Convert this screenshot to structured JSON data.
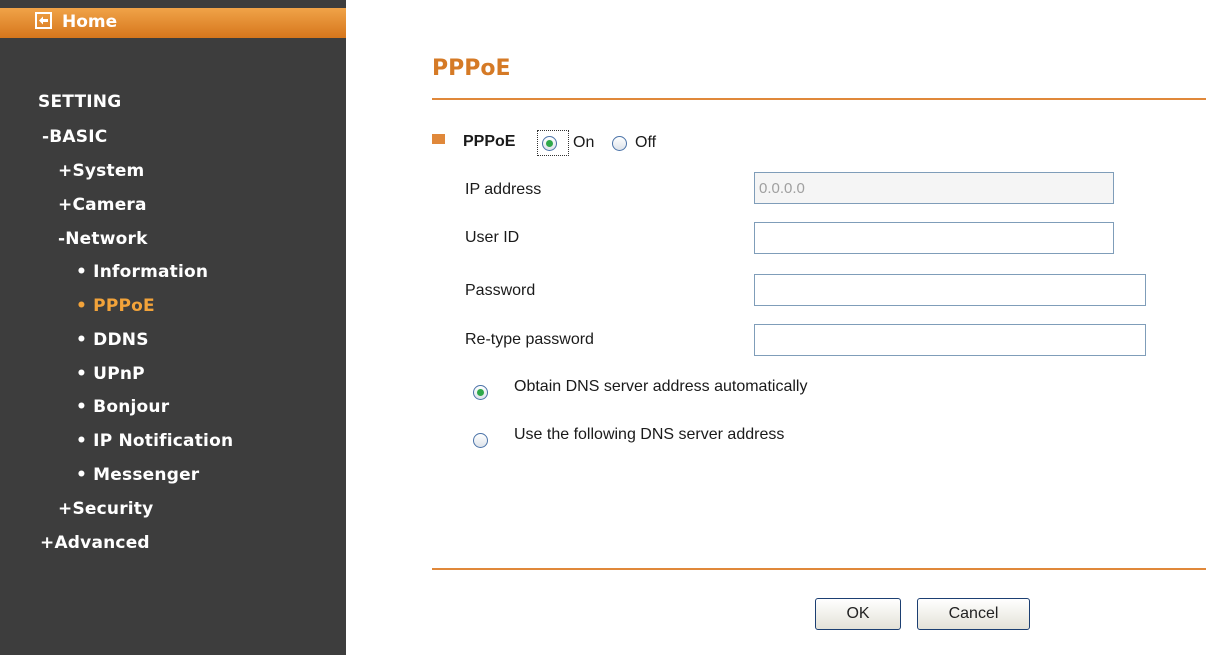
{
  "sidebar": {
    "home_label": "Home",
    "items": [
      {
        "label": "SETTING"
      },
      {
        "label": "-BASIC"
      },
      {
        "label": "+System"
      },
      {
        "label": "+Camera"
      },
      {
        "label": "-Network"
      },
      {
        "label": "• Information"
      },
      {
        "label": "• PPPoE"
      },
      {
        "label": "• DDNS"
      },
      {
        "label": "• UPnP"
      },
      {
        "label": "• Bonjour"
      },
      {
        "label": "• IP Notification"
      },
      {
        "label": "• Messenger"
      },
      {
        "label": "+Security"
      },
      {
        "label": "+Advanced"
      }
    ],
    "active_color": "#f2a33a"
  },
  "main": {
    "title": "PPPoE",
    "pppoe_label": "PPPoE",
    "on_label": "On",
    "off_label": "Off",
    "pppoe_selected": "On",
    "ip_address": {
      "label": "IP address",
      "value": "0.0.0.0"
    },
    "user_id": {
      "label": "User ID",
      "value": ""
    },
    "password": {
      "label": "Password",
      "value": ""
    },
    "retype_password": {
      "label": "Re-type password",
      "value": ""
    },
    "dns_auto_label": "Obtain DNS server address automatically",
    "dns_manual_label": "Use the following DNS server address",
    "dns_selected": "auto",
    "ok_label": "OK",
    "cancel_label": "Cancel"
  },
  "colors": {
    "accent": "#d57a26",
    "sidebar_bg": "#3d3d3d",
    "radio_dot": "#2fa84a"
  }
}
